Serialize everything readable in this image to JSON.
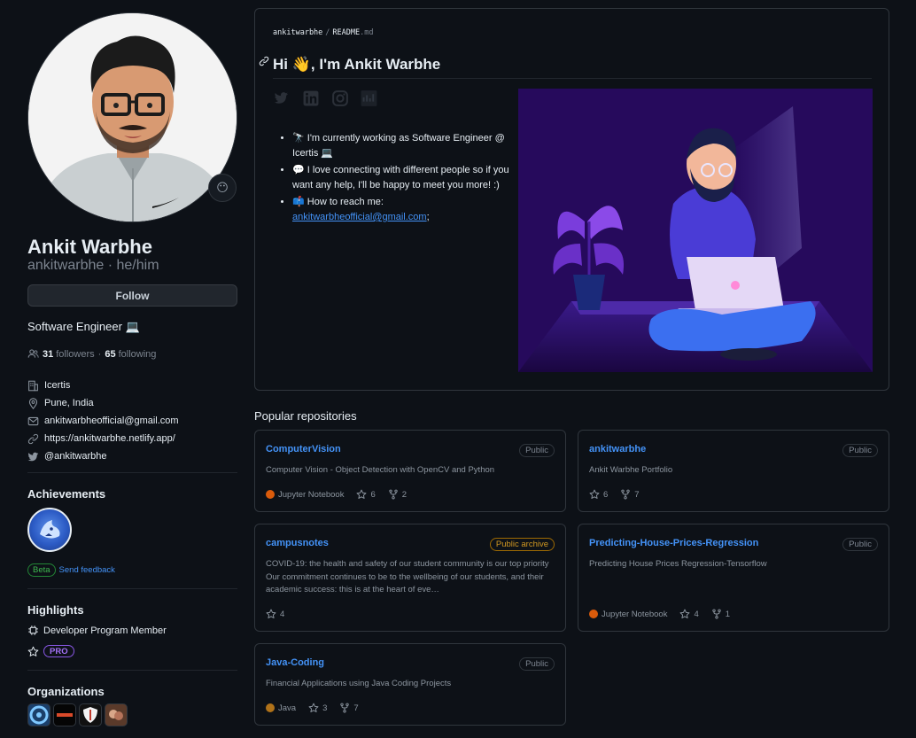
{
  "profile": {
    "name": "Ankit Warbhe",
    "username": "ankitwarbhe",
    "pronouns": "he/him",
    "follow_label": "Follow",
    "bio": "Software Engineer 💻",
    "followers_count": "31",
    "followers_label": "followers",
    "following_count": "65",
    "following_label": "following",
    "details": {
      "company": "Icertis",
      "location": "Pune, India",
      "email": "ankitwarbheofficial@gmail.com",
      "website": "https://ankitwarbhe.netlify.app/",
      "twitter": "@ankitwarbhe"
    }
  },
  "achievements": {
    "title": "Achievements",
    "beta_label": "Beta",
    "feedback_label": "Send feedback"
  },
  "highlights": {
    "title": "Highlights",
    "program": "Developer Program Member",
    "pro_label": "PRO"
  },
  "organizations": {
    "title": "Organizations",
    "items": [
      "org-1",
      "org-2",
      "org-3",
      "org-4"
    ]
  },
  "readme": {
    "path_user": "ankitwarbhe",
    "path_file": "README",
    "path_ext": ".md",
    "heading_prefix": "Hi",
    "heading_emoji": "👋",
    "heading_rest": ", I'm Ankit Warbhe",
    "social_icons": [
      "twitter-icon",
      "linkedin-icon",
      "instagram-icon",
      "medium-icon"
    ],
    "bullets": [
      {
        "emoji": "🔭",
        "text": "I'm currently working as Software Engineer @ Icertis 💻"
      },
      {
        "emoji": "💬",
        "text": "I love connecting with different people so if you want any help, I'll be happy to meet you more! :)"
      },
      {
        "emoji": "📫",
        "text": "How to reach me:",
        "link": "ankitwarbheofficial@gmail.com",
        "after": ";"
      }
    ]
  },
  "popular": {
    "title": "Popular repositories",
    "repos": [
      {
        "name": "ComputerVision",
        "visibility": "Public",
        "description": "Computer Vision - Object Detection with OpenCV and Python",
        "language": "Jupyter Notebook",
        "lang_color": "#DA5B0B",
        "stars": "6",
        "forks": "2"
      },
      {
        "name": "ankitwarbhe",
        "visibility": "Public",
        "description": "Ankit Warbhe Portfolio",
        "language": "",
        "lang_color": "",
        "stars": "6",
        "forks": "7"
      },
      {
        "name": "campusnotes",
        "visibility": "Public archive",
        "description": "COVID-19: the health and safety of our student community is our top priority Our commitment continues to be to the wellbeing of our students, and their academic success: this is at the heart of eve…",
        "language": "",
        "lang_color": "",
        "stars": "4",
        "forks": ""
      },
      {
        "name": "Predicting-House-Prices-Regression",
        "visibility": "Public",
        "description": "Predicting House Prices Regression-Tensorflow",
        "language": "Jupyter Notebook",
        "lang_color": "#DA5B0B",
        "stars": "4",
        "forks": "1"
      },
      {
        "name": "Java-Coding",
        "visibility": "Public",
        "description": "Financial Applications using Java Coding Projects",
        "language": "Java",
        "lang_color": "#b07219",
        "stars": "3",
        "forks": "7"
      }
    ]
  }
}
